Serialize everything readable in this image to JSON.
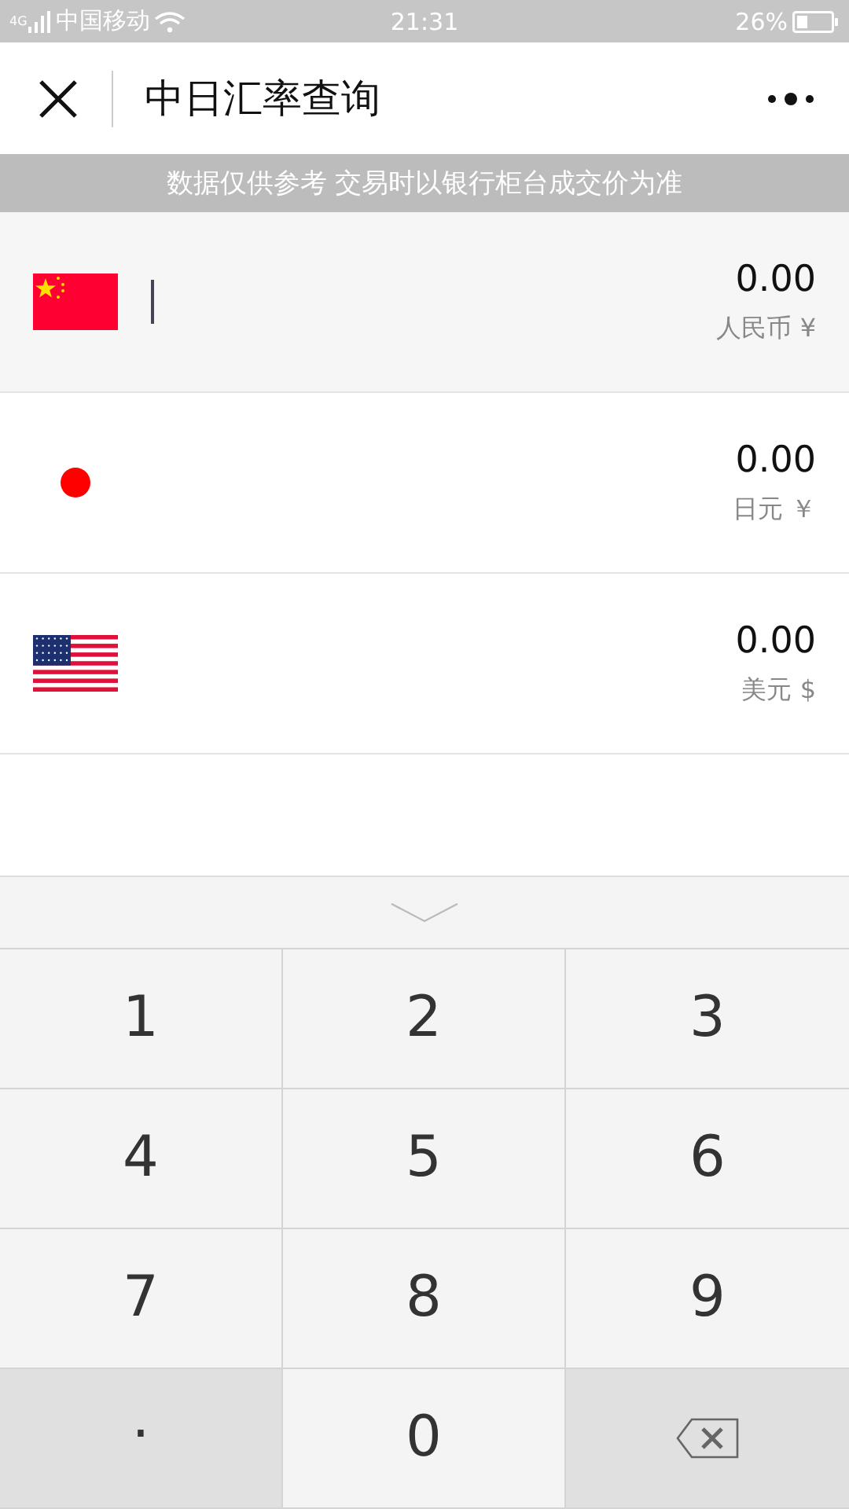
{
  "status_bar": {
    "network": "4G",
    "carrier": "中国移动",
    "time": "21:31",
    "battery": "26%"
  },
  "nav": {
    "title": "中日汇率查询"
  },
  "notice": "数据仅供参考 交易时以银行柜台成交价为准",
  "currencies": [
    {
      "kind": "cn",
      "amount": "0.00",
      "name": "人民币 ¥",
      "selected": true
    },
    {
      "kind": "jp",
      "amount": "0.00",
      "name": "日元 ￥",
      "selected": false
    },
    {
      "kind": "us",
      "amount": "0.00",
      "name": "美元 $",
      "selected": false
    }
  ],
  "keypad": [
    {
      "kind": "digit",
      "label": "1"
    },
    {
      "kind": "digit",
      "label": "2"
    },
    {
      "kind": "digit",
      "label": "3"
    },
    {
      "kind": "digit",
      "label": "4"
    },
    {
      "kind": "digit",
      "label": "5"
    },
    {
      "kind": "digit",
      "label": "6"
    },
    {
      "kind": "digit",
      "label": "7"
    },
    {
      "kind": "digit",
      "label": "8"
    },
    {
      "kind": "digit",
      "label": "9"
    },
    {
      "kind": "dot",
      "label": "."
    },
    {
      "kind": "digit",
      "label": "0"
    },
    {
      "kind": "backspace"
    }
  ]
}
